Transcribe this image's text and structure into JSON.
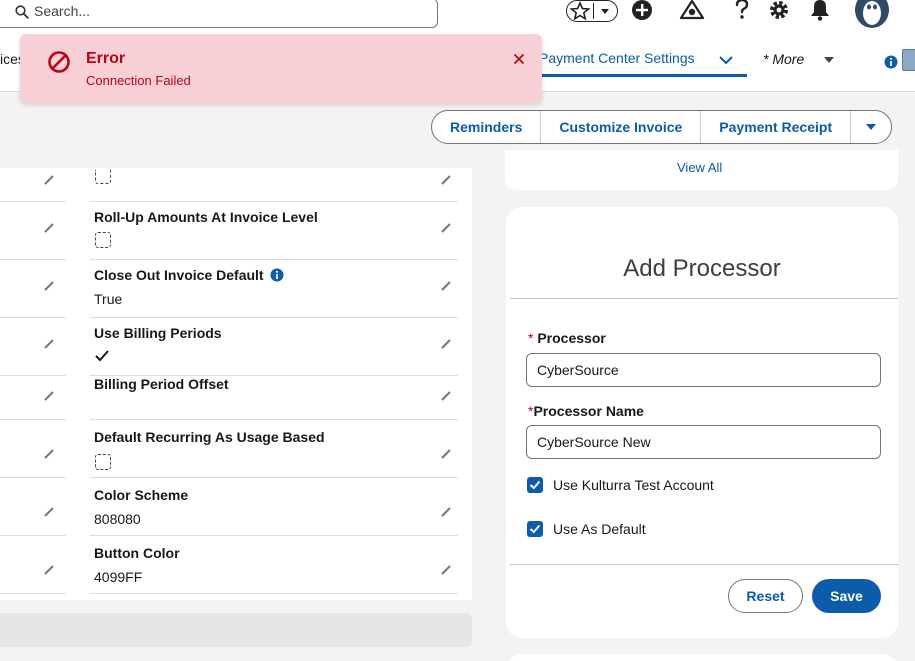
{
  "header": {
    "search_placeholder": "Search...",
    "icons": [
      "favorites-star-icon",
      "add-icon",
      "setup-assistant-icon",
      "help-icon",
      "gear-icon",
      "bell-icon",
      "avatar-icon"
    ]
  },
  "nav": {
    "truncated_tab": "ices",
    "active_tab": "Payment Center Settings",
    "more_label": "* More"
  },
  "toast": {
    "title": "Error",
    "message": "Connection Failed"
  },
  "actions": {
    "buttons": [
      "Reminders",
      "Customize Invoice",
      "Payment Receipt"
    ]
  },
  "settings": {
    "rows": [
      {
        "label": "",
        "type": "checkbox",
        "value": ""
      },
      {
        "label": "Roll-Up Amounts At Invoice Level",
        "type": "checkbox",
        "value": ""
      },
      {
        "label": "Close Out Invoice Default",
        "type": "text",
        "value": "True",
        "has_info": true
      },
      {
        "label": "Use Billing Periods",
        "type": "check",
        "value": ""
      },
      {
        "label": "Billing Period Offset",
        "type": "text",
        "value": ""
      },
      {
        "label": "Default Recurring As Usage Based",
        "type": "checkbox",
        "value": ""
      },
      {
        "label": "Color Scheme",
        "type": "text",
        "value": "808080"
      },
      {
        "label": "Button Color",
        "type": "text",
        "value": "4099FF"
      }
    ]
  },
  "right_top": {
    "link": "View All"
  },
  "processor_form": {
    "title": "Add Processor",
    "processor_label": "Processor",
    "processor_value": "CyberSource",
    "name_label": "Processor Name",
    "name_value": "CyberSource New",
    "required_mark": "*",
    "checkbox_test_account": "Use Kulturra Test Account",
    "checkbox_default": "Use As Default",
    "reset_label": "Reset",
    "save_label": "Save"
  },
  "colors": {
    "brand": "#0b5cab",
    "error": "#ba0517",
    "toast_bg": "#f9d0d6"
  }
}
